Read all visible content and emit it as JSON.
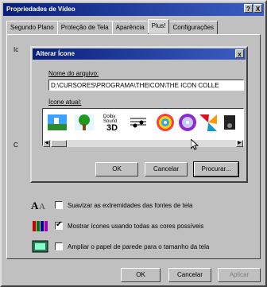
{
  "window": {
    "title": "Propriedades de Vídeo",
    "help": "?",
    "close": "X"
  },
  "tabs": [
    "Segundo Plano",
    "Proteção de Tela",
    "Aparência",
    "Plus!",
    "Configurações"
  ],
  "dialog": {
    "title": "Alterar Ícone",
    "close": "x",
    "filename_label": "Nome do arquivo:",
    "filename_value": "D:\\CURSORES\\PROGRAMA\\THEICON\\THE ICON COLLE",
    "current_icon_label": "Ícone atual:",
    "ok": "OK",
    "cancel": "Cancelar",
    "browse": "Procurar...",
    "icon_badge_text": [
      "Dolby",
      "Sound",
      "3D"
    ]
  },
  "options": [
    {
      "label": "Suavizar as extremidades das fontes de tela",
      "checked": false
    },
    {
      "label": "Mostrar ícones usando todas as cores possíveis",
      "checked": true
    },
    {
      "label": "Ampliar o papel de parede para o tamanho da tela",
      "checked": false
    }
  ],
  "footer": {
    "ok": "OK",
    "cancel": "Cancelar",
    "apply": "Aplicar"
  },
  "hidden_partial_labels": [
    "Ic",
    "C"
  ],
  "colors": {
    "title_bar_start": "#0a1f7a",
    "title_bar_end": "#3b5ec2",
    "face": "#c0c0c0"
  }
}
